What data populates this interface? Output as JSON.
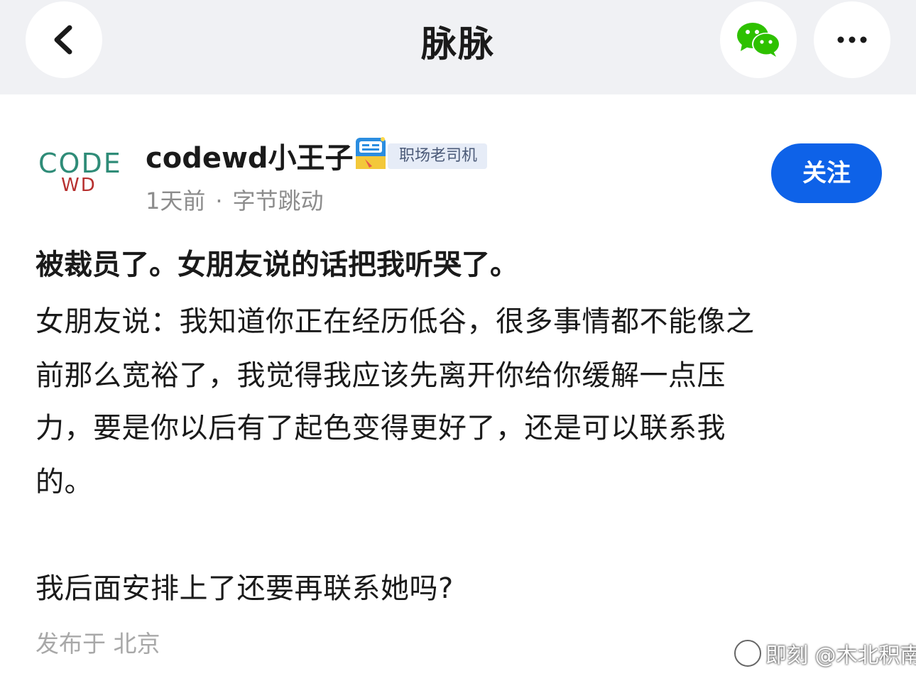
{
  "header": {
    "title": "脉脉",
    "back_icon": "chevron-left-icon",
    "wechat_icon": "wechat-icon",
    "more_icon": "more-dots-icon",
    "wechat_color": "#2ec100"
  },
  "author": {
    "logo_line1": "CODE",
    "logo_line2": "WD",
    "name": "codewd小王子",
    "badge_icon": "badge-icon",
    "tag": "职场老司机",
    "time": "1天前",
    "separator": "·",
    "company": "字节跳动",
    "follow_label": "关注",
    "follow_color": "#0e62e8"
  },
  "post": {
    "title": "被裁员了。女朋友说的话把我听哭了。",
    "lines": [
      "女朋友说：我知道你正在经历低谷，很多事情都不能像之",
      "前那么宽裕了，我觉得我应该先离开你给你缓解一点压",
      "力，要是你以后有了起色变得更好了，还是可以联系我",
      "的。",
      "我后面安排上了还要再联系她吗?"
    ],
    "location": "发布于 北京"
  },
  "watermark": {
    "text": "即刻 @木北积南"
  }
}
